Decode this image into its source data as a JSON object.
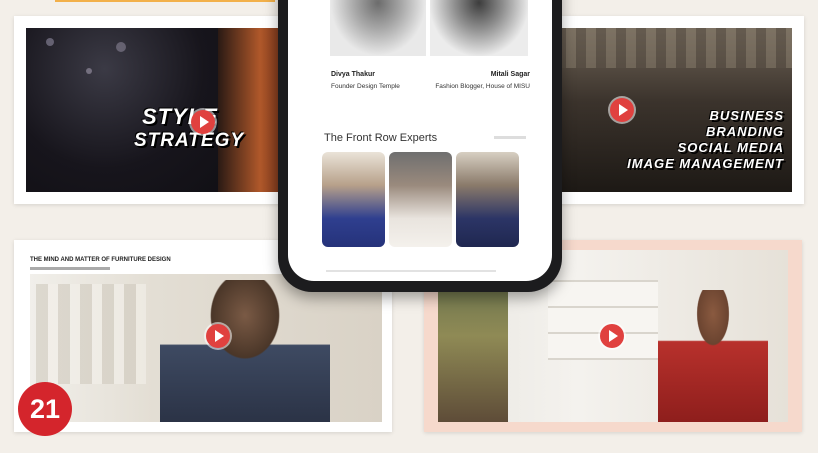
{
  "cards": {
    "style_strategy": {
      "overlay_line1": "STYLE",
      "overlay_line2": "STRATEGY"
    },
    "business_branding": {
      "overlay_lines": [
        "BUSINESS",
        "BRANDING",
        "SOCIAL MEDIA",
        "IMAGE MANAGEMENT"
      ]
    },
    "furniture": {
      "heading": "THE MIND AND MATTER OF FURNITURE DESIGN"
    }
  },
  "phone": {
    "people": [
      {
        "name": "Divya Thakur",
        "role": "Founder Design Temple"
      },
      {
        "name": "Mitali Sagar",
        "role": "Fashion Blogger, House of MISU"
      }
    ],
    "section_title": "The Front Row Experts"
  },
  "page_number": "21",
  "colors": {
    "play": "#e0413f",
    "badge": "#d4252c",
    "accent_line": "#f2b04a"
  },
  "icons": [
    "play-icon"
  ]
}
